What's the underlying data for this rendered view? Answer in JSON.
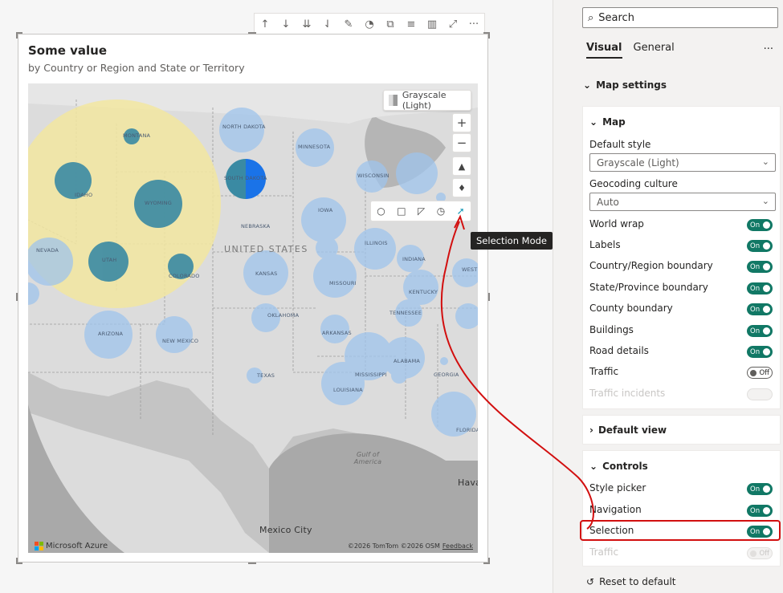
{
  "visual": {
    "title": "Some value",
    "subtitle": "by Country or Region and State or Territory",
    "toolbar_icons": [
      "arrow-up-icon",
      "arrow-down-icon",
      "double-arrow-down-icon",
      "expand-hierarchy-icon",
      "pin-icon",
      "bell-icon",
      "copy-visual-icon",
      "filter-icon",
      "format-icon",
      "focus-mode-icon",
      "more-options-icon"
    ]
  },
  "map": {
    "style_picker_label": "Grayscale (Light)",
    "zoom_in": "+",
    "zoom_out": "−",
    "tooltip": "Selection Mode",
    "brand": "Microsoft Azure",
    "copyright": "©2026 TomTom ©2026 OSM",
    "feedback": "Feedback",
    "country_label": "UNITED STATES",
    "gulf_label": "Gulf of America",
    "city_label": "Mexico City",
    "havana_label": "Hava",
    "state_labels": [
      "MONTANA",
      "NORTH DAKOTA",
      "MINNESOTA",
      "WISCONSIN",
      "IDAHO",
      "WYOMING",
      "SOUTH DAKOTA",
      "IOWA",
      "NEBRASKA",
      "NEVADA",
      "UTAH",
      "COLORADO",
      "KANSAS",
      "MISSOURI",
      "ILLINOIS",
      "INDIANA",
      "KENTUCKY",
      "TENNESSEE",
      "OKLAHOMA",
      "ARKANSAS",
      "ARIZONA",
      "NEW MEXICO",
      "TEXAS",
      "MISSISSIPPI",
      "ALABAMA",
      "GEORGIA",
      "LOUISIANA",
      "FLORIDA",
      "WEST"
    ]
  },
  "pane": {
    "search_placeholder": "Search",
    "tab_visual": "Visual",
    "tab_general": "General",
    "more": "···",
    "map_settings": "Map settings",
    "map_card_title": "Map",
    "default_style_label": "Default style",
    "default_style_value": "Grayscale (Light)",
    "geocoding_label": "Geocoding culture",
    "geocoding_value": "Auto",
    "toggles": [
      {
        "label": "World wrap",
        "state": "On"
      },
      {
        "label": "Labels",
        "state": "On"
      },
      {
        "label": "Country/Region boundary",
        "state": "On"
      },
      {
        "label": "State/Province boundary",
        "state": "On"
      },
      {
        "label": "County boundary",
        "state": "On"
      },
      {
        "label": "Buildings",
        "state": "On"
      },
      {
        "label": "Road details",
        "state": "On"
      },
      {
        "label": "Traffic",
        "state": "Off"
      },
      {
        "label": "Traffic incidents",
        "state": ""
      }
    ],
    "default_view": "Default view",
    "controls_title": "Controls",
    "controls": [
      {
        "label": "Style picker",
        "state": "On"
      },
      {
        "label": "Navigation",
        "state": "On"
      },
      {
        "label": "Selection",
        "state": "On"
      },
      {
        "label": "Traffic",
        "state": "Off"
      }
    ],
    "reset": "Reset to default"
  }
}
